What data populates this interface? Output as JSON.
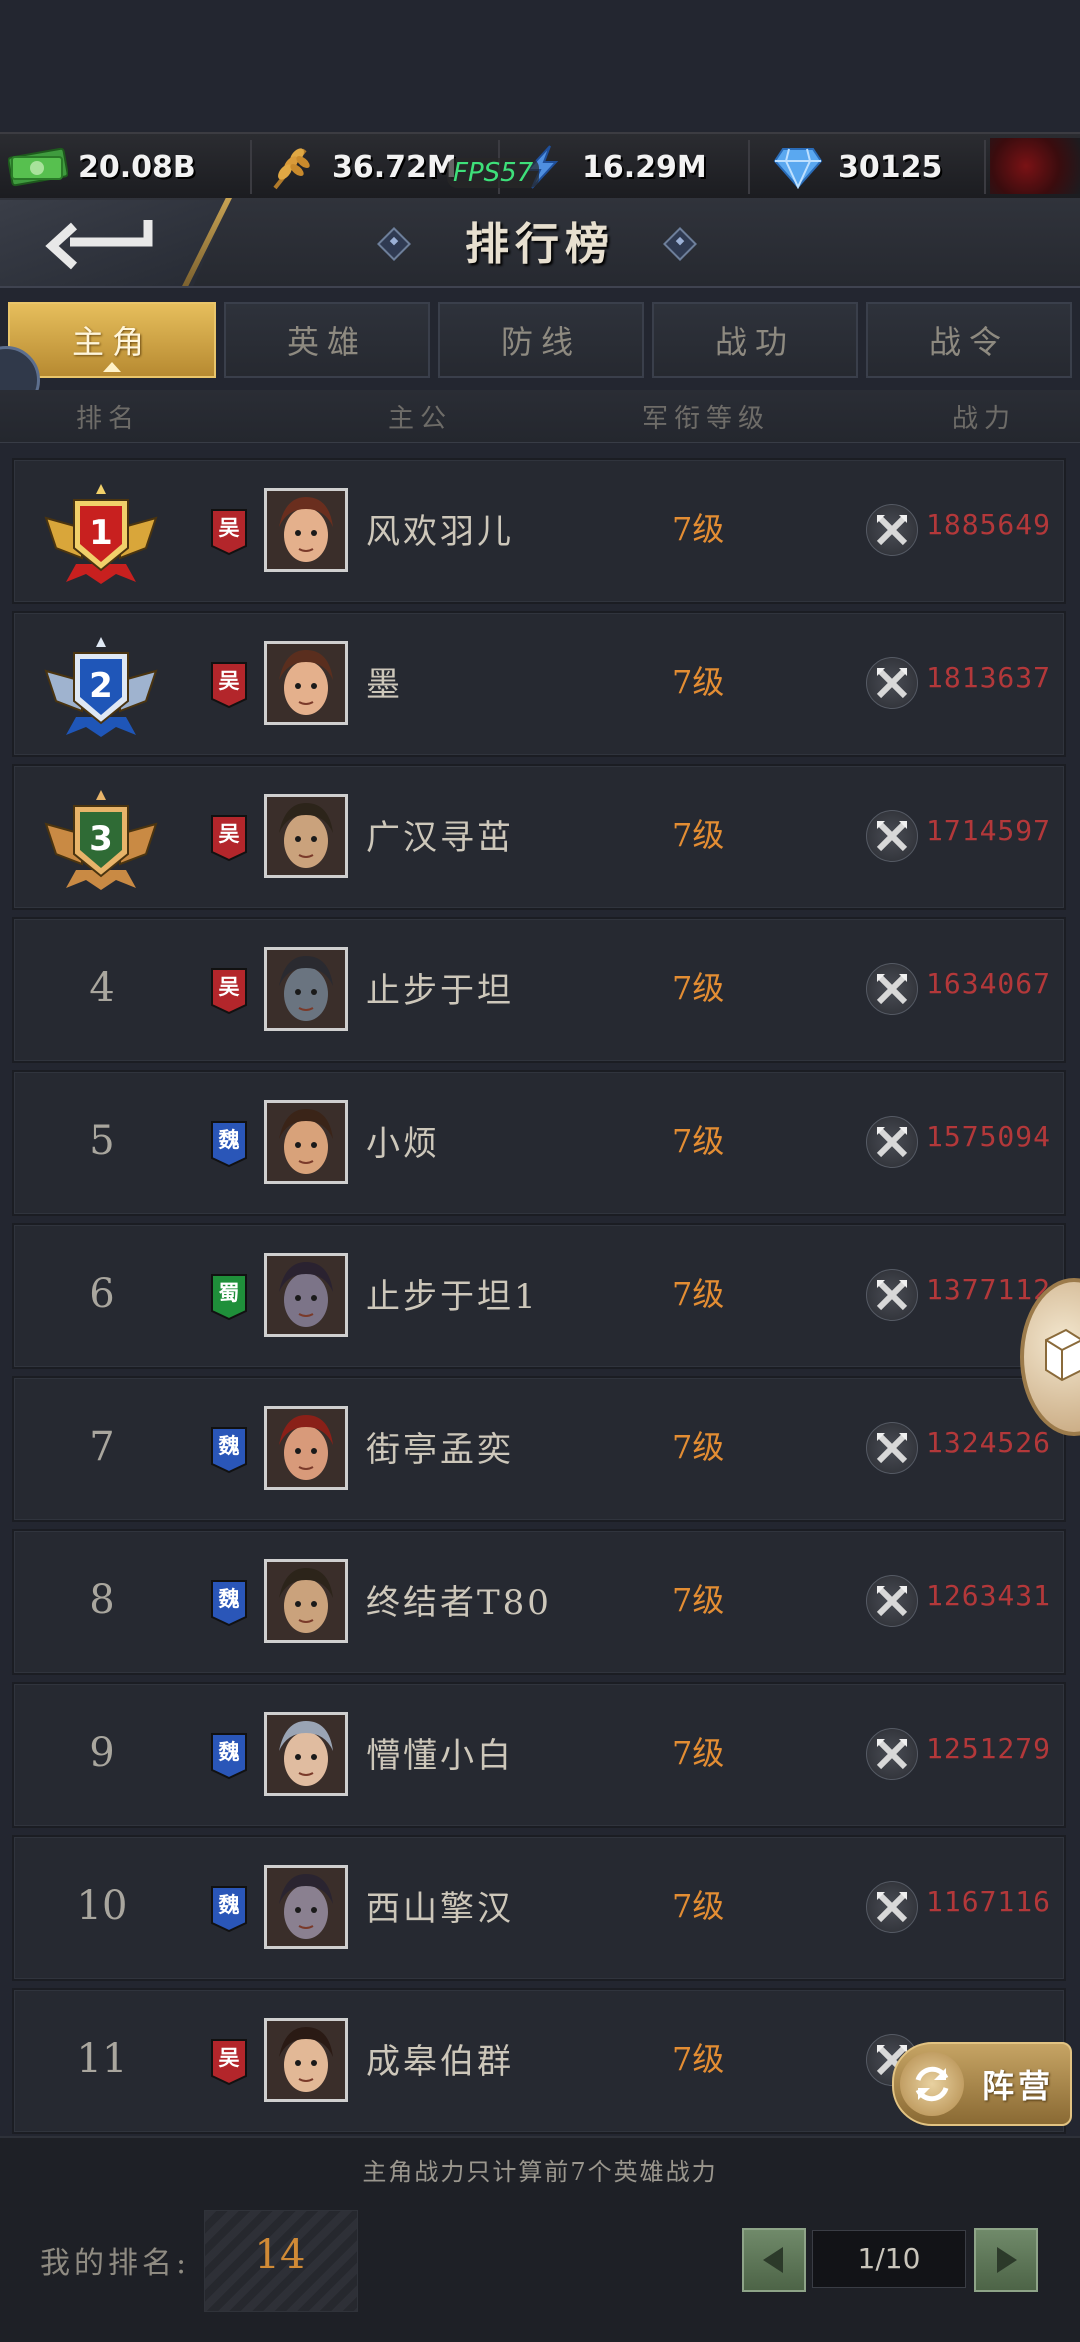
{
  "resources": [
    {
      "icon": "cash-icon",
      "value": "20.08B"
    },
    {
      "icon": "grain-icon",
      "value": "36.72M"
    },
    {
      "icon": "lightning-icon",
      "value": "16.29M"
    },
    {
      "icon": "diamond-gem-icon",
      "value": "30125"
    }
  ],
  "fps": "FPS57",
  "header": {
    "title": "排行榜"
  },
  "tabs": [
    {
      "label": "主角",
      "active": true
    },
    {
      "label": "英雄",
      "active": false
    },
    {
      "label": "防线",
      "active": false
    },
    {
      "label": "战功",
      "active": false
    },
    {
      "label": "战令",
      "active": false
    }
  ],
  "columns": {
    "rank": "排名",
    "lord": "主公",
    "rank_level": "军衔等级",
    "power": "战力"
  },
  "rows": [
    {
      "rank": "1",
      "faction": "吴",
      "faction_color": "#b3262b",
      "name": "风欢羽儿",
      "level": "7级",
      "power": "1885649"
    },
    {
      "rank": "2",
      "faction": "吴",
      "faction_color": "#b3262b",
      "name": "墨",
      "level": "7级",
      "power": "1813637"
    },
    {
      "rank": "3",
      "faction": "吴",
      "faction_color": "#b3262b",
      "name": "广汉寻茁",
      "level": "7级",
      "power": "1714597"
    },
    {
      "rank": "4",
      "faction": "吴",
      "faction_color": "#b3262b",
      "name": "止步于坦",
      "level": "7级",
      "power": "1634067"
    },
    {
      "rank": "5",
      "faction": "魏",
      "faction_color": "#2a56b8",
      "name": "小烦",
      "level": "7级",
      "power": "1575094"
    },
    {
      "rank": "6",
      "faction": "蜀",
      "faction_color": "#1f8f3a",
      "name": "止步于坦1",
      "level": "7级",
      "power": "1377112"
    },
    {
      "rank": "7",
      "faction": "魏",
      "faction_color": "#2a56b8",
      "name": "街亭孟奕",
      "level": "7级",
      "power": "1324526"
    },
    {
      "rank": "8",
      "faction": "魏",
      "faction_color": "#2a56b8",
      "name": "终结者T80",
      "level": "7级",
      "power": "1263431"
    },
    {
      "rank": "9",
      "faction": "魏",
      "faction_color": "#2a56b8",
      "name": "懵懂小白",
      "level": "7级",
      "power": "1251279"
    },
    {
      "rank": "10",
      "faction": "魏",
      "faction_color": "#2a56b8",
      "name": "西山擎汉",
      "level": "7级",
      "power": "1167116"
    },
    {
      "rank": "11",
      "faction": "吴",
      "faction_color": "#b3262b",
      "name": "成皋伯群",
      "level": "7级",
      "power": ""
    }
  ],
  "camp_button": {
    "label": "阵营"
  },
  "footer": {
    "note": "主角战力只计算前7个英雄战力",
    "my_rank_label": "我的排名:",
    "my_rank": "14",
    "page": "1/10"
  }
}
